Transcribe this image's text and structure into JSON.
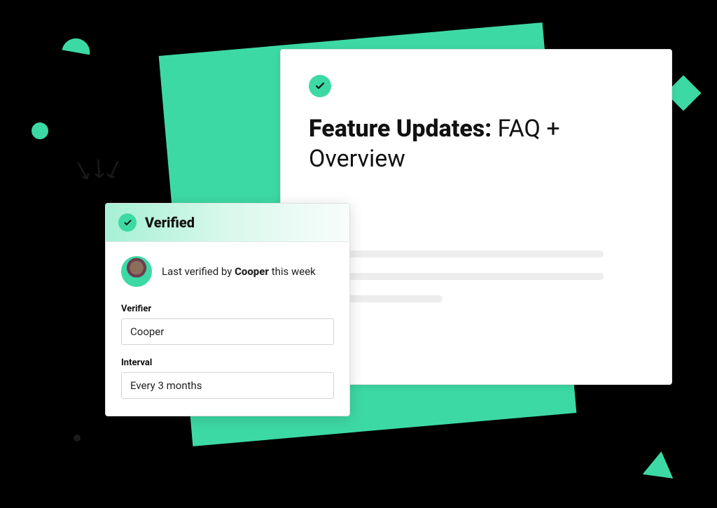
{
  "doc": {
    "title_bold": "Feature Updates:",
    "title_rest": " FAQ + Overview"
  },
  "verified": {
    "header": "Verified",
    "by_prefix": "Last verified by ",
    "by_name": "Cooper",
    "by_suffix": " this week",
    "verifier_label": "Verifier",
    "verifier_value": "Cooper",
    "interval_label": "Interval",
    "interval_value": "Every 3 months"
  },
  "colors": {
    "accent": "#3dd9a4"
  }
}
